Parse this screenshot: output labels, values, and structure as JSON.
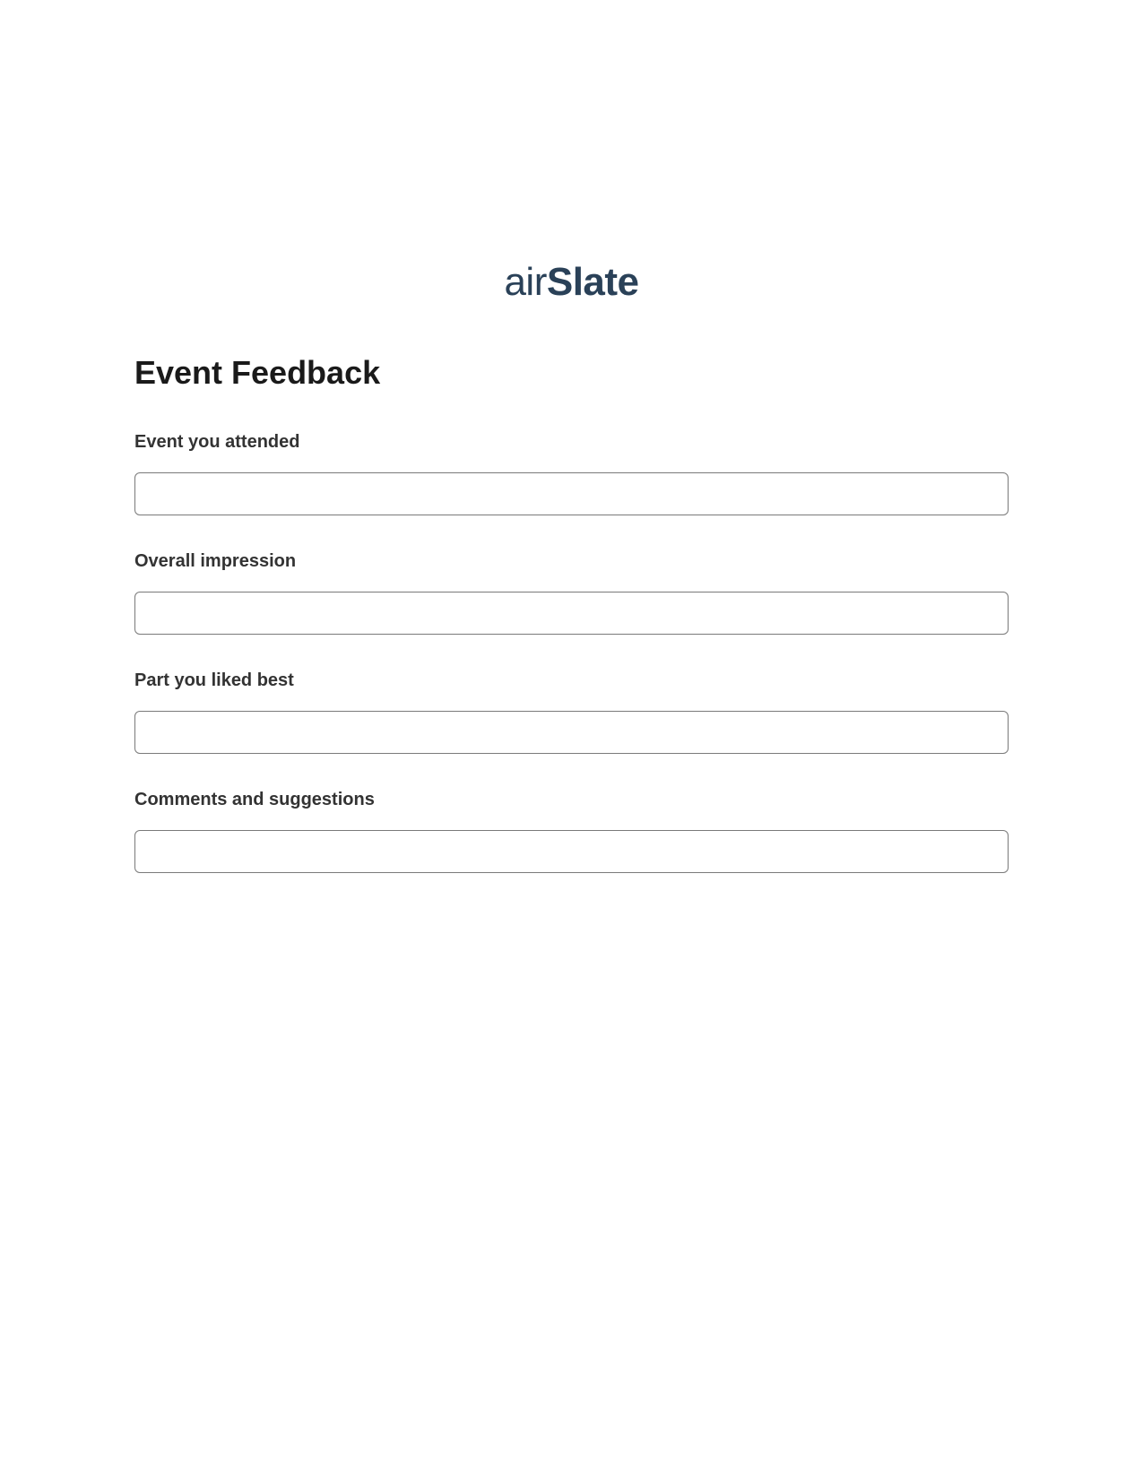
{
  "logo": {
    "part1": "air",
    "part2": "Slate"
  },
  "form": {
    "title": "Event Feedback",
    "fields": [
      {
        "label": "Event you attended",
        "value": ""
      },
      {
        "label": "Overall impression",
        "value": ""
      },
      {
        "label": "Part you liked best",
        "value": ""
      },
      {
        "label": "Comments and suggestions",
        "value": ""
      }
    ]
  }
}
